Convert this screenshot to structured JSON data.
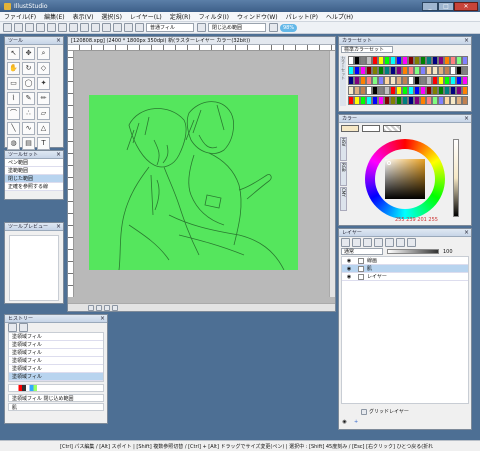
{
  "app": {
    "title": "IllustStudio"
  },
  "menu": [
    "ファイル(F)",
    "編集(E)",
    "表示(V)",
    "選択(S)",
    "レイヤー(L)",
    "定規(R)",
    "フィルタ(I)",
    "ウィンドウ(W)",
    "パレット(P)",
    "ヘルプ(H)"
  ],
  "toolbar": {
    "fill_label": "普通フィル",
    "mode_label": "閉じ込め範囲",
    "badge": "98%"
  },
  "document": {
    "tab": "[120808.xpg] (2400 * 1800px 350dpi)  新(ラスターレイヤー カラー(32bit))"
  },
  "tools": {
    "title": "ツール"
  },
  "subtool": {
    "title": "ツールセット",
    "items": [
      "ペン範囲",
      "塗範範囲",
      "閉じた範囲",
      "正確を参照する線"
    ],
    "selected_index": 2
  },
  "tool_preview": {
    "title": "ツールプレビュー"
  },
  "history": {
    "title": "ヒストリー",
    "items": [
      "塗領域フィル",
      "塗領域フィル",
      "塗領域フィル",
      "塗領域フィル",
      "塗領域フィル",
      "塗領域フィル"
    ],
    "selected_index": 5,
    "fill_name": "塗領域フィル 閉じ込め範囲",
    "layer_name": "肌"
  },
  "color_set": {
    "title": "カラーセット",
    "set_name": "標準カラーセット",
    "side_label": "カラーセット"
  },
  "color": {
    "title": "カラー",
    "values": "255 239 201 255",
    "tabs": [
      "HSV",
      "RGB",
      "CMY"
    ],
    "selected_hex": "#f6e8c6"
  },
  "layers": {
    "title": "レイヤー",
    "blend": "通常",
    "opacity": "100",
    "items": [
      {
        "name": "線画"
      },
      {
        "name": "肌"
      },
      {
        "name": "レイヤー"
      }
    ],
    "selected_index": 1,
    "grid_label": "グリッドレイヤー",
    "plus": "+"
  },
  "status": {
    "text": "[Ctrl] パス編集 / [Alt] スポイト | [Shift] 複数参照切替 / [Ctrl] + [Alt] ドラッグでサイズ変更(ペン) | 選択中 : [Shift] 45度刻み / [Esc] [右クリック] ひとつ戻る(折れ"
  },
  "colors": {
    "canvas": "#55e65d",
    "line": "#2a7a30",
    "accent": "#3a7bd5"
  }
}
